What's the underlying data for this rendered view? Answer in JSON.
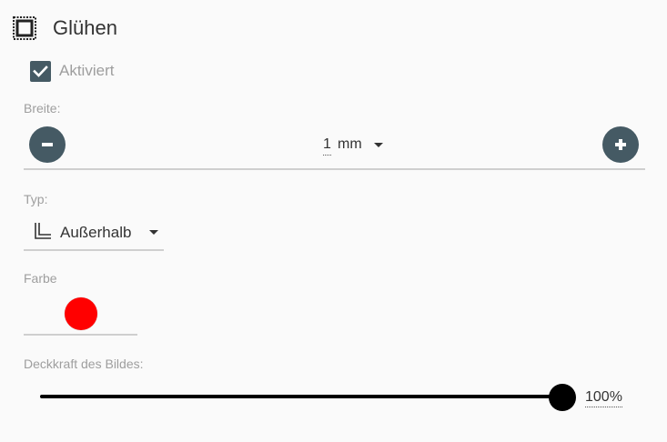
{
  "section": {
    "title": "Glühen",
    "icon": "glow-frame-icon"
  },
  "enabled": {
    "label": "Aktiviert",
    "checked": true
  },
  "width": {
    "label": "Breite:",
    "value": "1",
    "unit": "mm",
    "decrement_icon": "minus-icon",
    "increment_icon": "plus-icon"
  },
  "type": {
    "label": "Typ:",
    "value": "Außerhalb",
    "icon": "outer-corner-icon"
  },
  "color": {
    "label": "Farbe",
    "value": "#ff0000"
  },
  "opacity": {
    "label": "Deckkraft des Bildes:",
    "value_text": "100%",
    "value": 1.0
  },
  "colors": {
    "accent": "#455a64",
    "label_gray": "#9e9e9e",
    "underline": "#cfcfcf"
  }
}
